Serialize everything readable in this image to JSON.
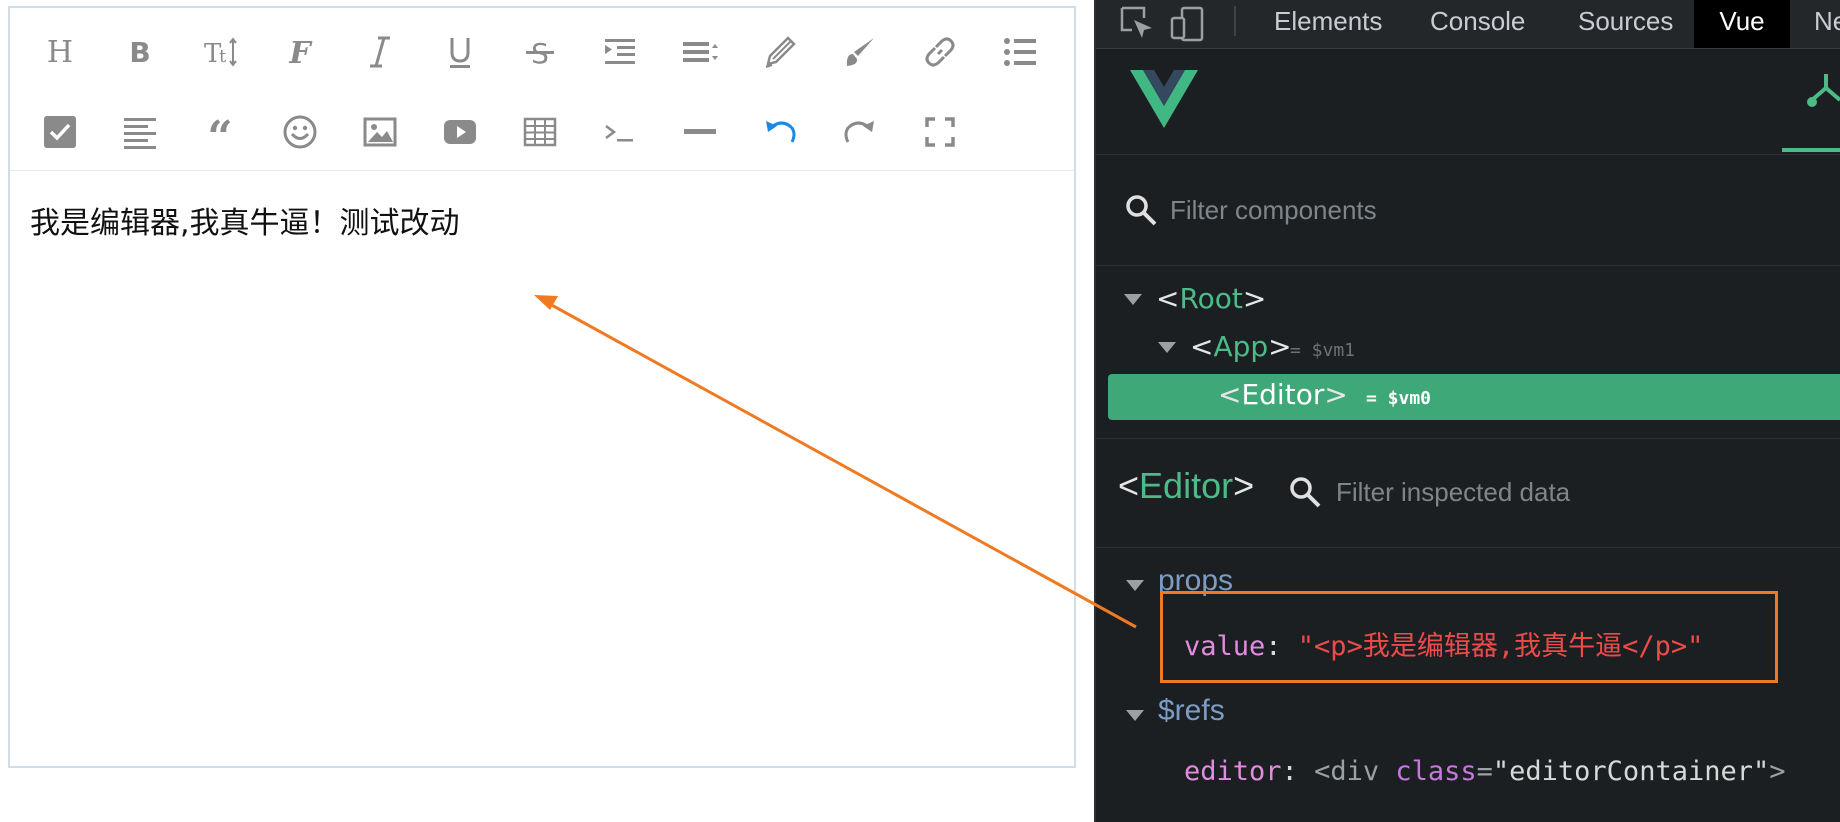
{
  "editor": {
    "toolbar": [
      {
        "name": "heading-button",
        "icon": "heading-icon"
      },
      {
        "name": "bold-button",
        "icon": "bold-icon"
      },
      {
        "name": "font-size-button",
        "icon": "font-size-icon"
      },
      {
        "name": "font-family-button",
        "icon": "font-family-icon"
      },
      {
        "name": "italic-button",
        "icon": "italic-icon"
      },
      {
        "name": "underline-button",
        "icon": "underline-icon"
      },
      {
        "name": "strikethrough-button",
        "icon": "strikethrough-icon"
      },
      {
        "name": "indent-button",
        "icon": "indent-icon"
      },
      {
        "name": "line-height-button",
        "icon": "line-height-icon"
      },
      {
        "name": "text-color-button",
        "icon": "pen-icon"
      },
      {
        "name": "background-color-button",
        "icon": "brush-icon"
      },
      {
        "name": "link-button",
        "icon": "link-icon"
      },
      {
        "name": "list-button",
        "icon": "list-icon"
      },
      {
        "name": "todo-button",
        "icon": "checkbox-icon"
      },
      {
        "name": "justify-button",
        "icon": "align-left-icon"
      },
      {
        "name": "quote-button",
        "icon": "quote-icon"
      },
      {
        "name": "emoji-button",
        "icon": "emoji-icon"
      },
      {
        "name": "image-button",
        "icon": "image-icon"
      },
      {
        "name": "video-button",
        "icon": "video-icon"
      },
      {
        "name": "table-button",
        "icon": "table-icon"
      },
      {
        "name": "code-button",
        "icon": "code-icon"
      },
      {
        "name": "divider-button",
        "icon": "divider-icon"
      },
      {
        "name": "undo-button",
        "icon": "undo-icon"
      },
      {
        "name": "redo-button",
        "icon": "redo-icon"
      },
      {
        "name": "fullscreen-button",
        "icon": "fullscreen-icon"
      }
    ],
    "content_text": "我是编辑器,我真牛逼！测试改动"
  },
  "devtools": {
    "tabs": [
      "Elements",
      "Console",
      "Sources",
      "Vue",
      "Ne"
    ],
    "active_tab": "Vue",
    "filter_components_placeholder": "Filter components",
    "tree": [
      {
        "open": "<",
        "name": "Root",
        "close": ">",
        "ref": ""
      },
      {
        "open": "<",
        "name": "App",
        "close": ">",
        "ref": "= $vm1"
      },
      {
        "open": "<",
        "name": "Editor",
        "close": ">",
        "ref": "= $vm0"
      }
    ],
    "inspected": {
      "open": "<",
      "name": "Editor",
      "close": ">",
      "filter_placeholder": "Filter inspected data"
    },
    "props": {
      "title": "props",
      "key": "value",
      "colon": ": ",
      "value": "\"<p>我是编辑器,我真牛逼</p>\""
    },
    "refs": {
      "title": "$refs",
      "key": "editor",
      "colon": ": ",
      "tag_open": "<div ",
      "attr": "class",
      "eq": "=",
      "attr_value": "\"editorContainer\"",
      "tag_close": ">"
    }
  },
  "colors": {
    "vue_green": "#4dba87",
    "selected_row": "#3ea878",
    "annotation_orange": "#f07a22",
    "undo_blue": "#1e88e5",
    "icon_gray": "#8a8a8a"
  }
}
